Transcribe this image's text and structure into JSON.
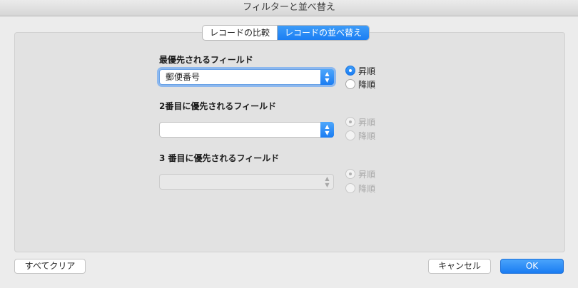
{
  "window": {
    "title": "フィルターと並べ替え"
  },
  "tabs": [
    {
      "label": "レコードの比較",
      "selected": false
    },
    {
      "label": "レコードの並べ替え",
      "selected": true
    }
  ],
  "sort_fields": [
    {
      "label": "最優先されるフィールド",
      "value": "郵便番号",
      "enabled": true,
      "ascending_label": "昇順",
      "descending_label": "降順",
      "order": "ascending"
    },
    {
      "label": "2番目に優先されるフィールド",
      "value": "",
      "enabled": true,
      "ascending_label": "昇順",
      "descending_label": "降順",
      "order": "ascending"
    },
    {
      "label": "3 番目に優先されるフィールド",
      "value": "",
      "enabled": false,
      "ascending_label": "昇順",
      "descending_label": "降順",
      "order": "ascending"
    }
  ],
  "footer": {
    "clear_all_label": "すべてクリア",
    "cancel_label": "キャンセル",
    "ok_label": "OK"
  },
  "colors": {
    "accent": "#1b7ef3"
  }
}
